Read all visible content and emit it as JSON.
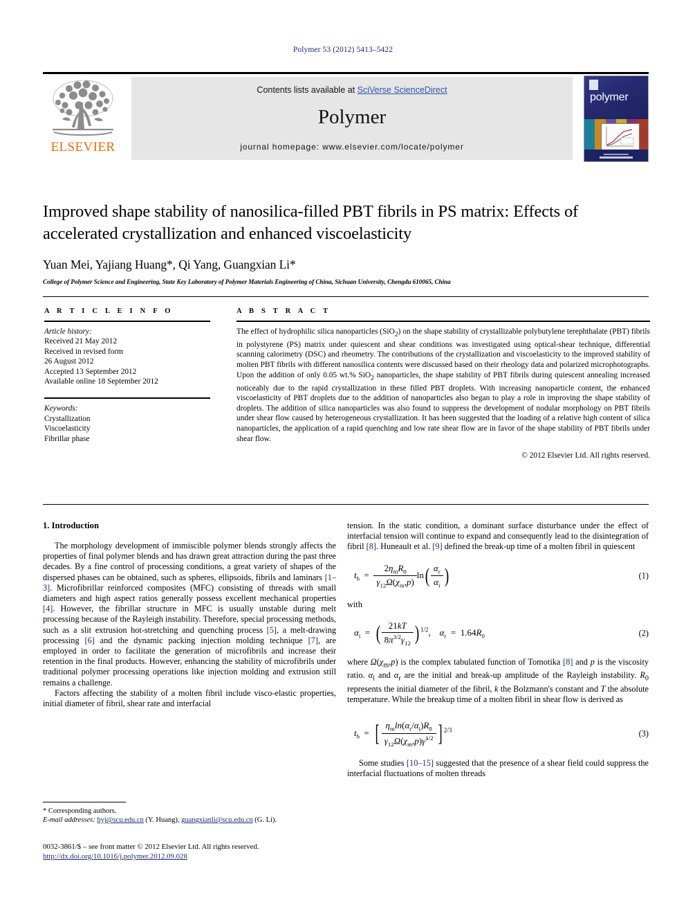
{
  "running_head": "Polymer 53 (2012) 5413–5422",
  "banner": {
    "contents_prefix": "Contents lists available at ",
    "contents_link": "SciVerse ScienceDirect",
    "journal_name": "Polymer",
    "homepage": "journal homepage: www.elsevier.com/locate/polymer",
    "publisher_name": "ELSEVIER",
    "cover_title": "polymer"
  },
  "article": {
    "title": "Improved shape stability of nanosilica-filled PBT fibrils in PS matrix: Effects of accelerated crystallization and enhanced viscoelasticity",
    "authors": "Yuan Mei, Yajiang Huang*, Qi Yang, Guangxian Li*",
    "affiliation": "College of Polymer Science and Engineering, State Key Laboratory of Polymer Materials Engineering of China, Sichuan University, Chengdu 610065, China"
  },
  "info": {
    "heading": "A R T I C L E   I N F O",
    "history_label": "Article history:",
    "history": [
      "Received 21 May 2012",
      "Received in revised form",
      "26 August 2012",
      "Accepted 13 September 2012",
      "Available online 18 September 2012"
    ],
    "keywords_label": "Keywords:",
    "keywords": [
      "Crystallization",
      "Viscoelasticity",
      "Fibrillar phase"
    ]
  },
  "abstract": {
    "heading": "A B S T R A C T",
    "text": "The effect of hydrophilic silica nanoparticles (SiO2) on the shape stability of crystallizable polybutylene terephthalate (PBT) fibrils in polystyrene (PS) matrix under quiescent and shear conditions was investigated using optical-shear technique, differential scanning calorimetry (DSC) and rheometry. The contributions of the crystallization and viscoelasticity to the improved stability of molten PBT fibrils with different nanosilica contents were discussed based on their rheology data and polarized microphotographs. Upon the addition of only 0.05 wt.% SiO2 nanoparticles, the shape stability of PBT fibrils during quiescent annealing increased noticeably due to the rapid crystallization in these filled PBT droplets. With increasing nanoparticle content, the enhanced viscoelasticity of PBT droplets due to the addition of nanoparticles also began to play a role in improving the shape stability of droplets. The addition of silica nanoparticles was also found to suppress the development of nodular morphology on PBT fibrils under shear flow caused by heterogeneous crystallization. It has been suggested that the loading of a relative high content of silica nanoparticles, the application of a rapid quenching and low rate shear flow are in favor of the shape stability of PBT fibrils under shear flow.",
    "copyright": "© 2012 Elsevier Ltd. All rights reserved."
  },
  "body": {
    "section_title": "1. Introduction",
    "left_para_1": "The morphology development of immiscible polymer blends strongly affects the properties of final polymer blends and has drawn great attraction during the past three decades. By a fine control of processing conditions, a great variety of shapes of the dispersed phases can be obtained, such as spheres, ellipsoids, fibrils and laminars [1–3]. Microfibrillar reinforced composites (MFC) consisting of threads with small diameters and high aspect ratios generally possess excellent mechanical properties [4]. However, the fibrillar structure in MFC is usually unstable during melt processing because of the Rayleigh instability. Therefore, special processing methods, such as a slit extrusion hot-stretching and quenching process [5], a melt-drawing processing [6] and the dynamic packing injection molding technique [7], are employed in order to facilitate the generation of microfibrils and increase their retention in the final products. However, enhancing the stability of microfibrils under traditional polymer processing operations like injection molding and extrusion still remains a challenge.",
    "left_para_2": "Factors affecting the stability of a molten fibril include visco-elastic properties, initial diameter of fibril, shear rate and interfacial",
    "right_para_1": "tension. In the static condition, a dominant surface disturbance under the effect of interfacial tension will continue to expand and consequently lead to the disintegration of fibril [8]. Huneault et al. [9] defined the break-up time of a molten fibril in quiescent",
    "with_label": "with",
    "right_para_2": "where Ω(χm,p) is the complex tabulated function of Tomotika [8] and p is the viscosity ratio. αi and αr are the initial and break-up amplitude of the Rayleigh instability. R0 represents the initial diameter of the fibril, k the Bolzmann's constant and T the absolute temperature. While the breakup time of a molten fibril in shear flow is derived as",
    "right_para_3": "Some studies [10–15] suggested that the presence of a shear field could suppress the interfacial fluctuations of molten threads"
  },
  "equations": {
    "eq1_number": "(1)",
    "eq2_number": "(2)",
    "eq3_number": "(3)"
  },
  "footnote": {
    "corresponding": "* Corresponding authors.",
    "email_label": "E-mail addresses:",
    "email1": "hyj@scu.edu.cn",
    "email1_owner": "(Y. Huang),",
    "email2": "guangxianli@scu.edu.cn",
    "email2_owner": "(G. Li)."
  },
  "publisher_footer": {
    "issn_line": "0032-3861/$ – see front matter © 2012 Elsevier Ltd. All rights reserved.",
    "doi": "http://dx.doi.org/10.1016/j.polymer.2012.09.028"
  }
}
